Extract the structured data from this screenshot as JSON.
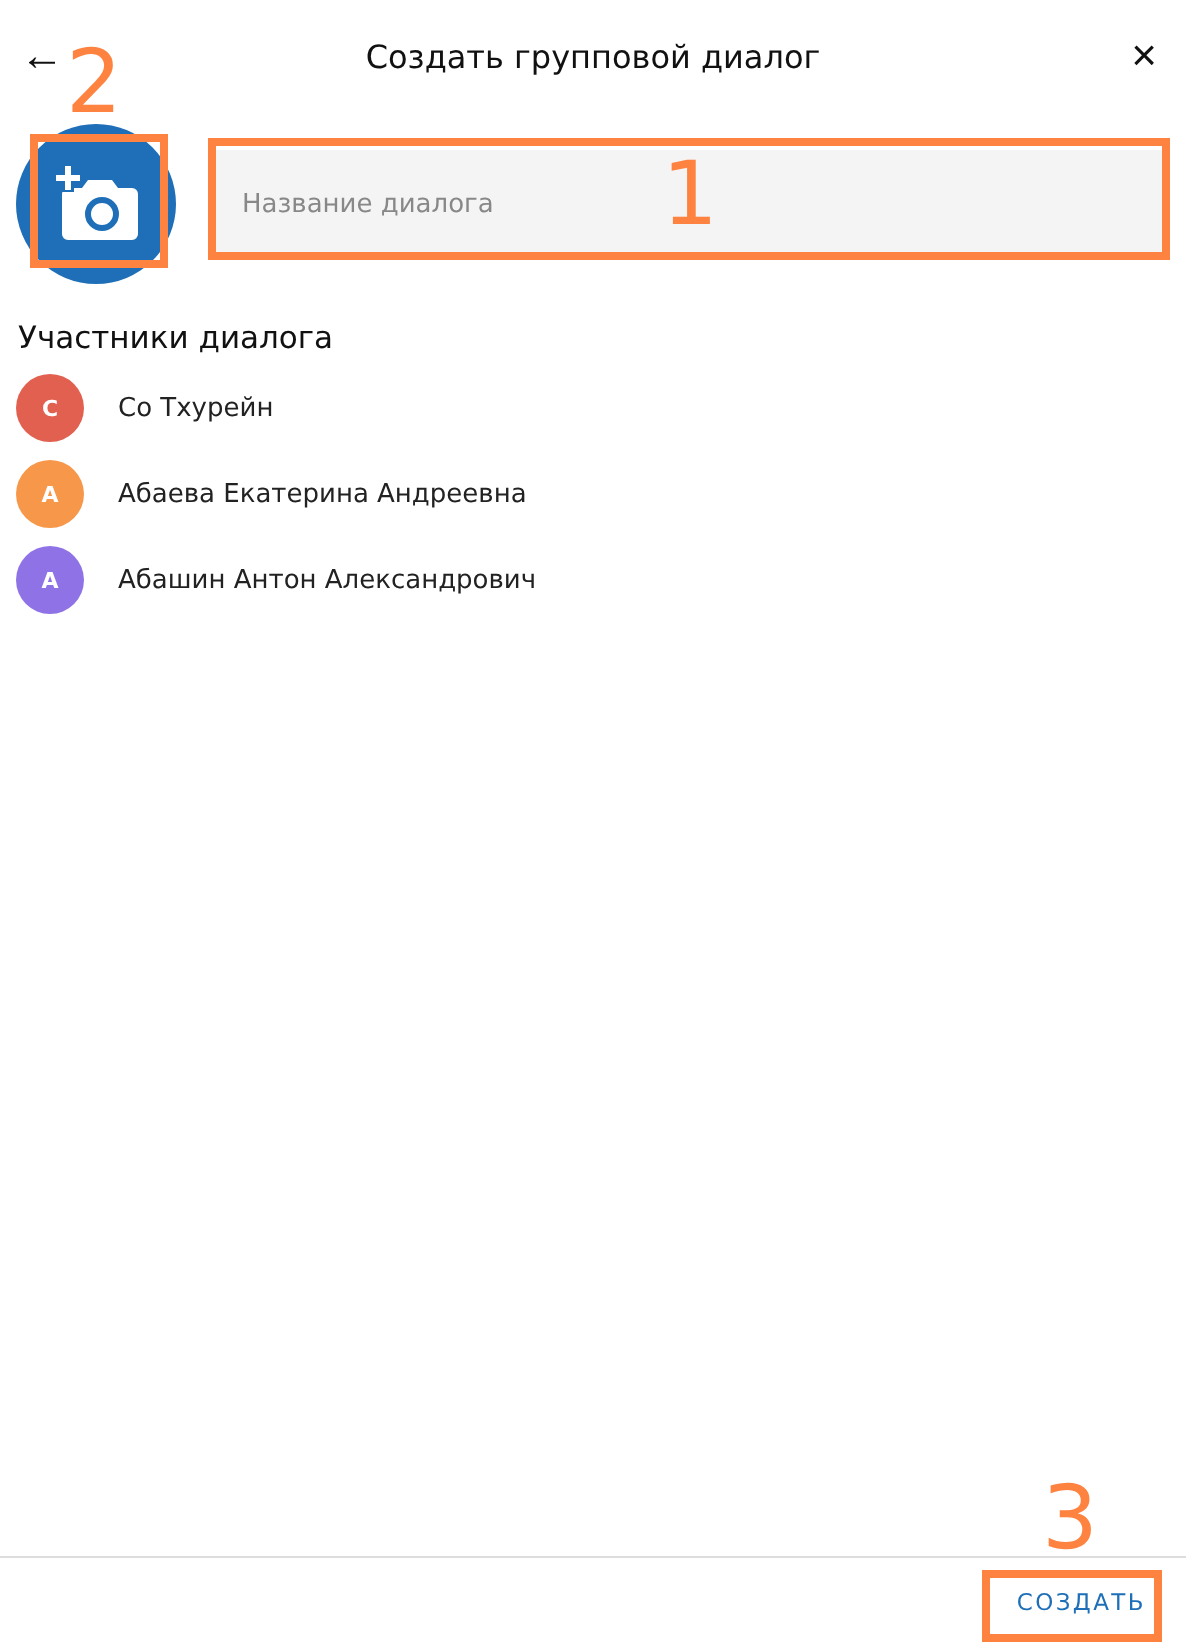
{
  "header": {
    "back": "←",
    "title": "Создать групповой диалог",
    "close": "×"
  },
  "photo": {
    "annotation": "2"
  },
  "name_field": {
    "placeholder": "Название диалога",
    "annotation": "1"
  },
  "members": {
    "title": "Участники диалога",
    "items": [
      {
        "initial": "С",
        "name": "Со Тхурейн",
        "color": "#e2604f"
      },
      {
        "initial": "А",
        "name": "Абаева Екатерина Андреевна",
        "color": "#f7974a"
      },
      {
        "initial": "А",
        "name": "Абашин Антон Александрович",
        "color": "#8f73e6"
      }
    ]
  },
  "footer": {
    "button": "СОЗДАТЬ",
    "annotation": "3"
  }
}
